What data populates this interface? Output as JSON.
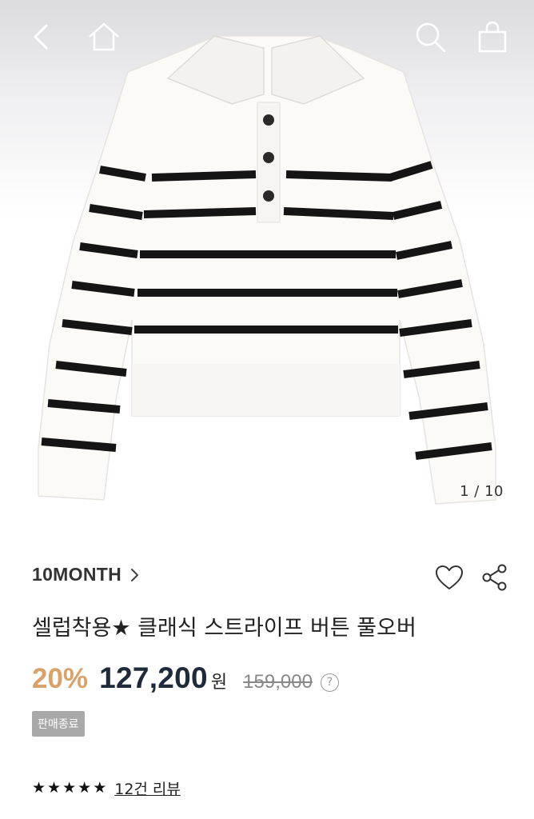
{
  "header": {
    "back_icon": "chevron-left-icon",
    "home_icon": "home-icon",
    "search_icon": "search-icon",
    "bag_icon": "shopping-bag-icon"
  },
  "gallery": {
    "counter": "1 / 10",
    "image": "white-striped-button-pullover"
  },
  "product": {
    "brand": "10MONTH",
    "title": "셀럽착용★ 클래식 스트라이프 버튼 풀오버",
    "discount": "20%",
    "price": "127,200",
    "currency": "원",
    "original_price": "159,000",
    "help_glyph": "?",
    "status_badge": "판매종료",
    "rating_stars": 5,
    "review_text": "12건 리뷰"
  },
  "colors": {
    "discount": "#d9a26a",
    "price": "#1f2a3a",
    "badge_bg": "#a9a9a9"
  }
}
